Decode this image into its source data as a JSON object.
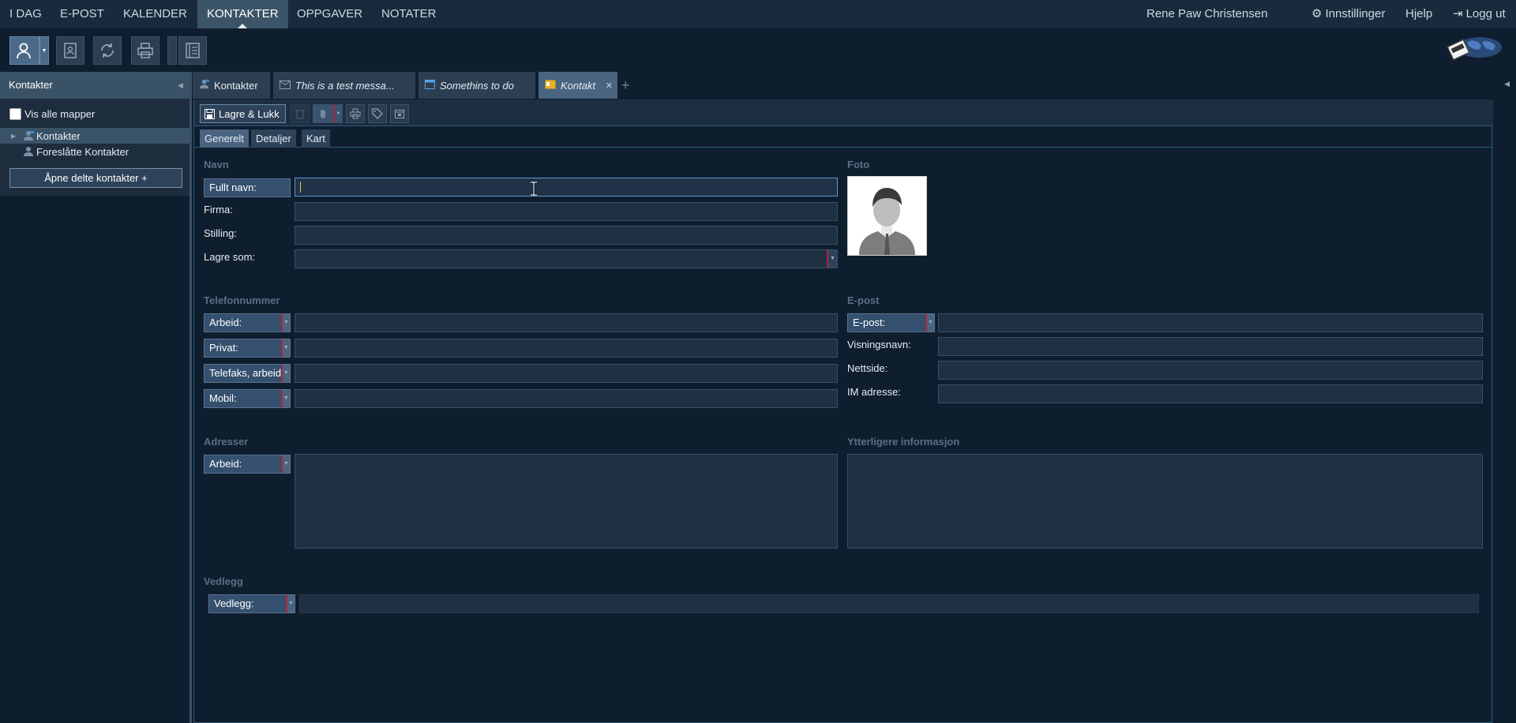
{
  "nav": {
    "items": [
      "I DAG",
      "E-POST",
      "KALENDER",
      "KONTAKTER",
      "OPPGAVER",
      "NOTATER"
    ],
    "active": "KONTAKTER",
    "user": "Rene Paw Christensen",
    "settings": "Innstillinger",
    "help": "Hjelp",
    "logout": "Logg ut"
  },
  "toolbar": {
    "icons": [
      "new-contact-icon",
      "address-book-icon",
      "sync-icon",
      "print-icon",
      "list-view-icon"
    ]
  },
  "sidebar": {
    "title": "Kontakter",
    "show_all": "Vis alle mapper",
    "folders": [
      {
        "label": "Kontakter",
        "selected": true
      },
      {
        "label": "Foreslåtte Kontakter",
        "selected": false
      }
    ],
    "open_shared": "Åpne delte kontakter +"
  },
  "tabs": [
    {
      "label": "Kontakter",
      "icon": "contact-icon"
    },
    {
      "label": "This is a test messa...",
      "icon": "mail-icon"
    },
    {
      "label": "Somethins to do",
      "icon": "calendar-icon"
    },
    {
      "label": "Kontakt",
      "icon": "contact-card-icon",
      "active": true
    }
  ],
  "form": {
    "save_close": "Lagre & Lukk",
    "subtabs": [
      "Generelt",
      "Detaljer",
      "Kart"
    ],
    "name_section": "Navn",
    "full_name_label": "Fullt navn:",
    "company_label": "Firma:",
    "title_label": "Stilling:",
    "save_as_label": "Lagre som:",
    "photo_section": "Foto",
    "phone_section": "Telefonnummer",
    "phone_labels": [
      "Arbeid:",
      "Privat:",
      "Telefaks, arbeid:",
      "Mobil:"
    ],
    "email_section": "E-post",
    "email_label": "E-post:",
    "display_name_label": "Visningsnavn:",
    "website_label": "Nettside:",
    "im_label": "IM adresse:",
    "address_section": "Adresser",
    "address_label": "Arbeid:",
    "extra_section": "Ytterligere informasjon",
    "attachments_section": "Vedlegg",
    "attachments_label": "Vedlegg:"
  },
  "colors": {
    "background": "#0f1e2e",
    "accent": "#4a6480",
    "focus": "#5a9ad0",
    "dropdown_marker": "#b0243a"
  }
}
